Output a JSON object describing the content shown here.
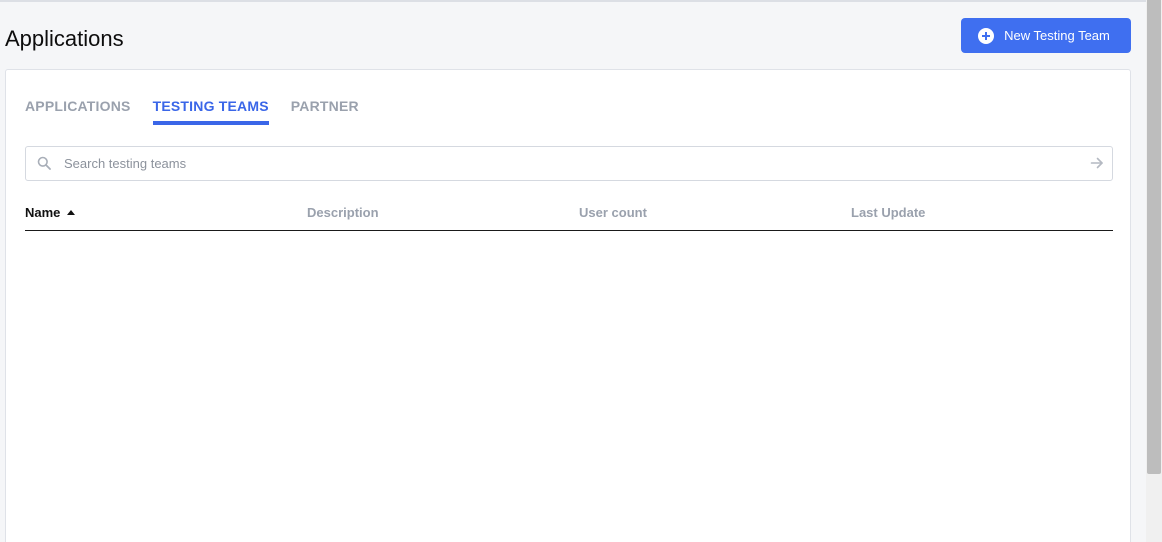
{
  "page": {
    "title": "Applications"
  },
  "header": {
    "new_team_button": {
      "label": "New Testing Team",
      "icon": "plus-circle-icon"
    }
  },
  "tabs": [
    {
      "label": "APPLICATIONS",
      "active": false
    },
    {
      "label": "TESTING TEAMS",
      "active": true
    },
    {
      "label": "PARTNER",
      "active": false
    }
  ],
  "search": {
    "placeholder": "Search testing teams",
    "value": "",
    "icon": "search-icon",
    "submit_icon": "arrow-right-icon"
  },
  "table": {
    "columns": [
      {
        "label": "Name",
        "sorted": "asc"
      },
      {
        "label": "Description"
      },
      {
        "label": "User count"
      },
      {
        "label": "Last Update"
      }
    ],
    "rows": []
  },
  "colors": {
    "accent": "#3f6ff0",
    "active_tab": "#3a66e8",
    "muted_text": "#9aa1ad",
    "background": "#f5f6f8"
  }
}
